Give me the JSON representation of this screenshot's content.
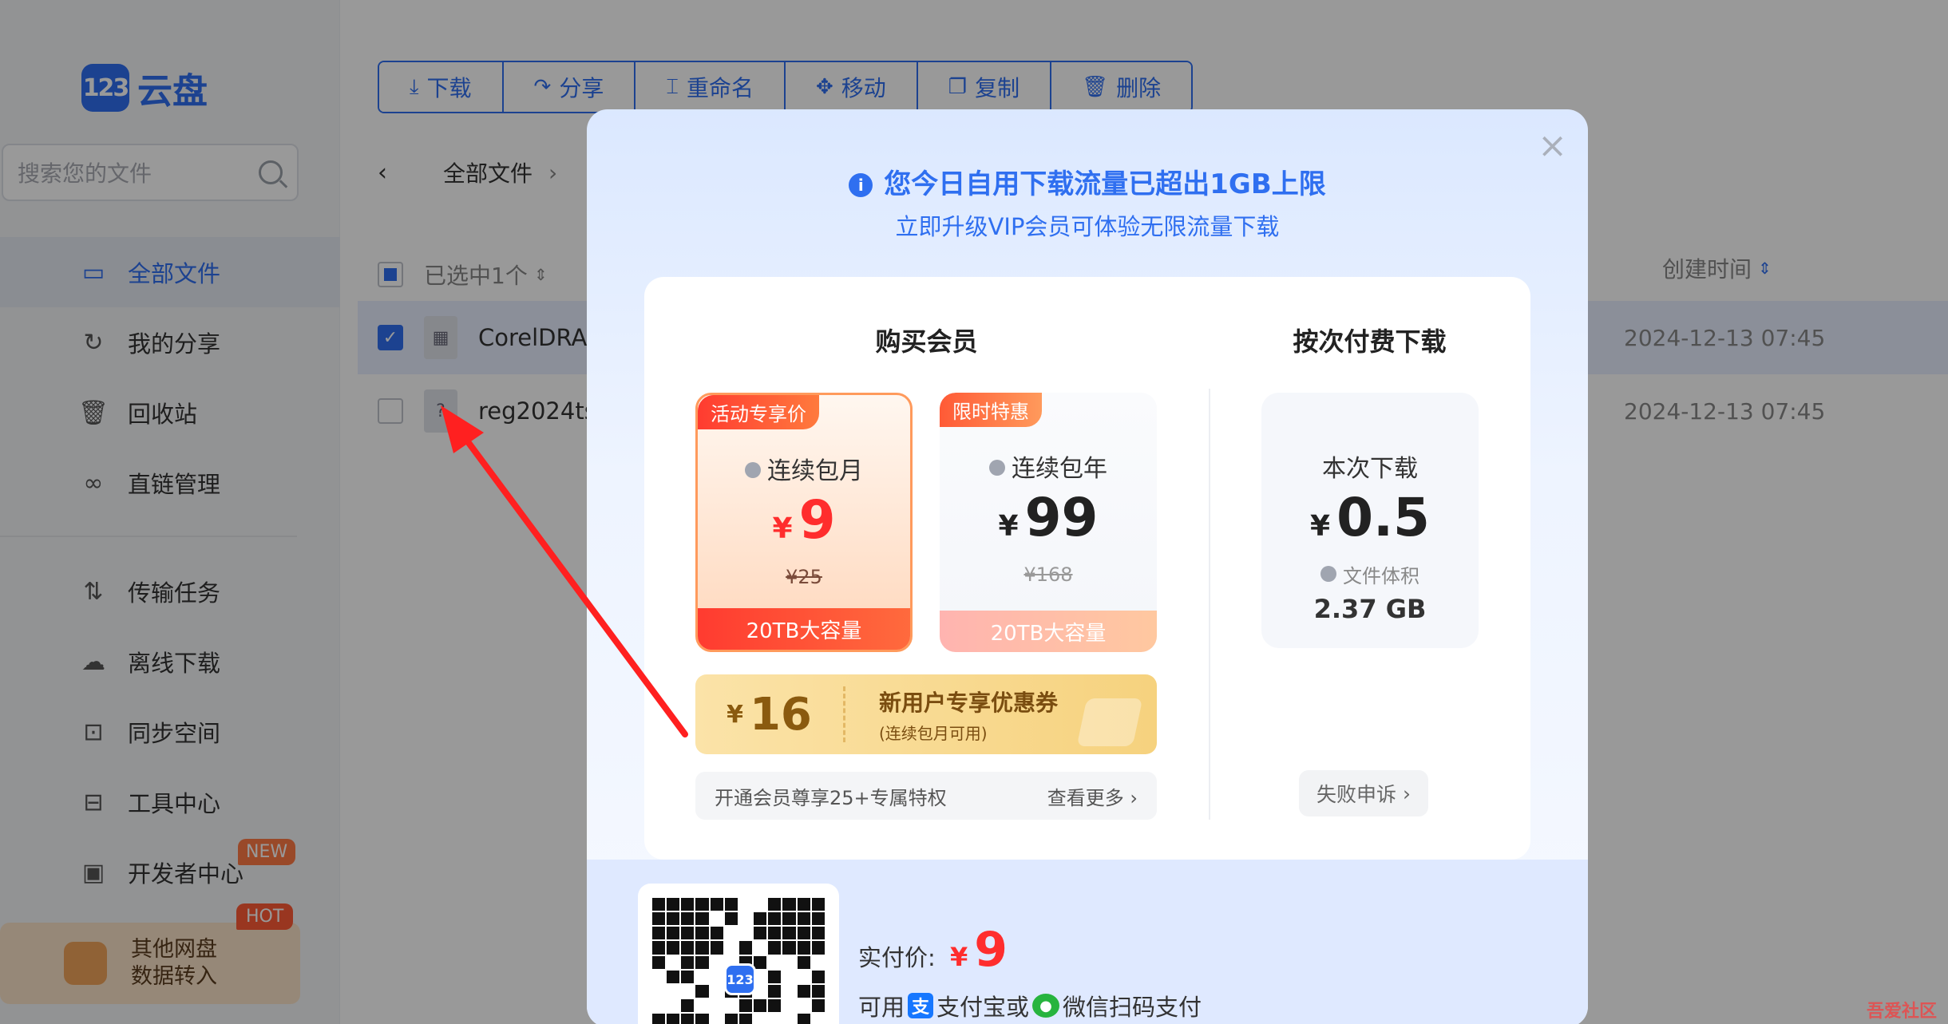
{
  "sidebar": {
    "logo_badge": "123",
    "logo_text": "云盘",
    "search_placeholder": "搜索您的文件",
    "items_top": [
      {
        "label": "全部文件",
        "icon": "folder-icon",
        "active": true
      },
      {
        "label": "我的分享",
        "icon": "share-icon"
      },
      {
        "label": "回收站",
        "icon": "trash-icon"
      },
      {
        "label": "直链管理",
        "icon": "link-icon"
      }
    ],
    "items_bottom": [
      {
        "label": "传输任务",
        "icon": "transfer-icon"
      },
      {
        "label": "离线下载",
        "icon": "cloud-download-icon"
      },
      {
        "label": "同步空间",
        "icon": "sync-icon"
      },
      {
        "label": "工具中心",
        "icon": "toolbox-icon"
      },
      {
        "label": "开发者中心",
        "icon": "terminal-icon",
        "badge": "NEW"
      }
    ],
    "promo": {
      "line1": "其他网盘",
      "line2": "数据转入",
      "badge": "HOT"
    }
  },
  "toolbar": {
    "buttons": [
      {
        "label": "下载",
        "icon": "download-icon"
      },
      {
        "label": "分享",
        "icon": "share-icon"
      },
      {
        "label": "重命名",
        "icon": "rename-icon"
      },
      {
        "label": "移动",
        "icon": "move-icon"
      },
      {
        "label": "复制",
        "icon": "copy-icon"
      },
      {
        "label": "删除",
        "icon": "delete-icon"
      }
    ]
  },
  "breadcrumb": {
    "current": "全部文件"
  },
  "file_list": {
    "selected_text": "已选中1个",
    "created_header": "创建时间",
    "rows": [
      {
        "name": "CorelDRA",
        "date": "2024-12-13 07:45",
        "checked": true
      },
      {
        "name": "reg2024ts",
        "date": "2024-12-13 07:45",
        "checked": false
      }
    ]
  },
  "modal": {
    "title": "您今日自用下载流量已超出1GB上限",
    "subtitle": "立即升级VIP会员可体验无限流量下载",
    "buy_title": "购买会员",
    "pay_per_title": "按次付费下载",
    "plans": [
      {
        "tag": "活动专享价",
        "name": "连续包月",
        "currency": "¥",
        "price": "9",
        "old_price": "¥25",
        "footer": "20TB大容量"
      },
      {
        "tag": "限时特惠",
        "name": "连续包年",
        "currency": "¥",
        "price": "99",
        "old_price": "¥168",
        "footer": "20TB大容量"
      }
    ],
    "coupon": {
      "currency": "¥",
      "amount": "16",
      "main": "新用户专享优惠券",
      "sub": "(连续包月可用)"
    },
    "perks": {
      "text": "开通会员尊享25+专属特权",
      "more": "查看更多"
    },
    "pay_per": {
      "label": "本次下载",
      "currency": "¥",
      "price": "0.5",
      "size_label": "文件体积",
      "size": "2.37 GB",
      "appeal": "失败申诉"
    },
    "payment": {
      "label": "实付价:",
      "currency": "¥",
      "price": "9",
      "methods_prefix": "可用",
      "alipay": "支付宝或",
      "wechat": "微信扫码支付",
      "qr_logo": "123"
    }
  },
  "watermark": "吾爱社区",
  "colors": {
    "accent": "#2f6ff0",
    "price_red": "#ff2d2d",
    "annotation": "#ff2020"
  }
}
